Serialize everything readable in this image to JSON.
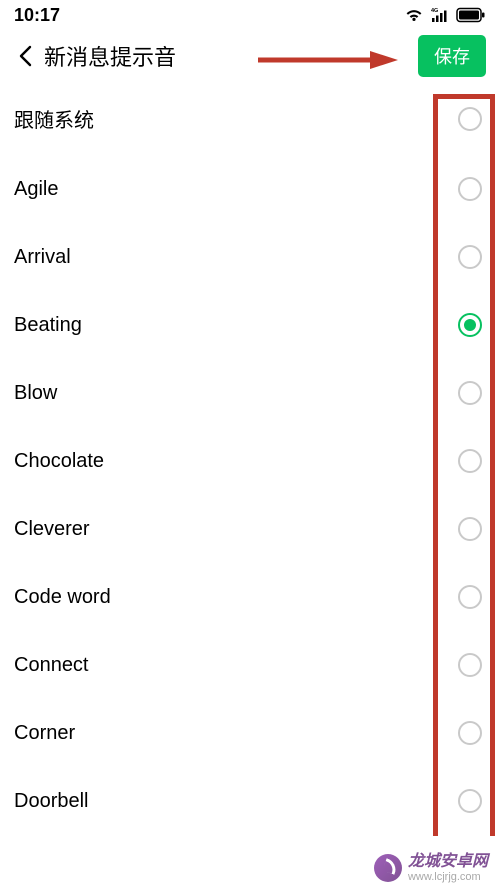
{
  "status_bar": {
    "time": "10:17"
  },
  "header": {
    "title": "新消息提示音",
    "save_label": "保存"
  },
  "sound_list": {
    "selected_index": 3,
    "items": [
      {
        "label": "跟随系统"
      },
      {
        "label": "Agile"
      },
      {
        "label": "Arrival"
      },
      {
        "label": "Beating"
      },
      {
        "label": "Blow"
      },
      {
        "label": "Chocolate"
      },
      {
        "label": "Cleverer"
      },
      {
        "label": "Code word"
      },
      {
        "label": "Connect"
      },
      {
        "label": "Corner"
      },
      {
        "label": "Doorbell"
      }
    ]
  },
  "watermark": {
    "cn": "龙城安卓网",
    "en": "www.lcjrjg.com"
  },
  "annotation": {
    "arrow_color": "#c0392b",
    "highlight_color": "#c0392b"
  }
}
